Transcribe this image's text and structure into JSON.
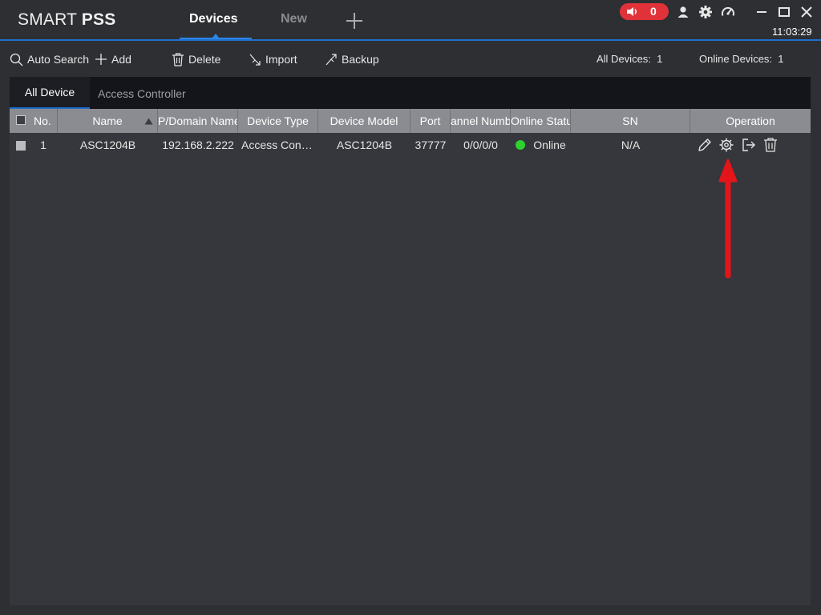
{
  "app": {
    "logo_light": "SMART",
    "logo_bold": "PSS",
    "tabs": {
      "devices": "Devices",
      "new": "New"
    },
    "alarm_count": "0",
    "clock": "11:03:29",
    "accent": "#1e6fd0",
    "alarm_color": "#e1323a"
  },
  "toolbar": {
    "auto_search": "Auto Search",
    "add": "Add",
    "delete": "Delete",
    "import": "Import",
    "backup": "Backup",
    "all_devices_label": "All Devices:",
    "all_devices_value": "1",
    "online_devices_label": "Online Devices:",
    "online_devices_value": "1"
  },
  "subtabs": {
    "all": "All Device",
    "access": "Access Controller"
  },
  "table": {
    "headers": {
      "no": "No.",
      "name": "Name",
      "ip": "P/Domain Name",
      "type": "Device Type",
      "model": "Device Model",
      "port": "Port",
      "channel": "annel Numb",
      "status": "Online Status",
      "sn": "SN",
      "operation": "Operation"
    },
    "rows": [
      {
        "no": "1",
        "name": "ASC1204B",
        "ip": "192.168.2.222",
        "type": "Access Controller",
        "model": "ASC1204B",
        "port": "37777",
        "channel": "0/0/0/0",
        "status": "Online",
        "sn": "N/A"
      }
    ],
    "status_online_color": "#2fd12f"
  },
  "annotation": {
    "arrow_color": "#e3141a",
    "target": "settings-gear-icon"
  }
}
